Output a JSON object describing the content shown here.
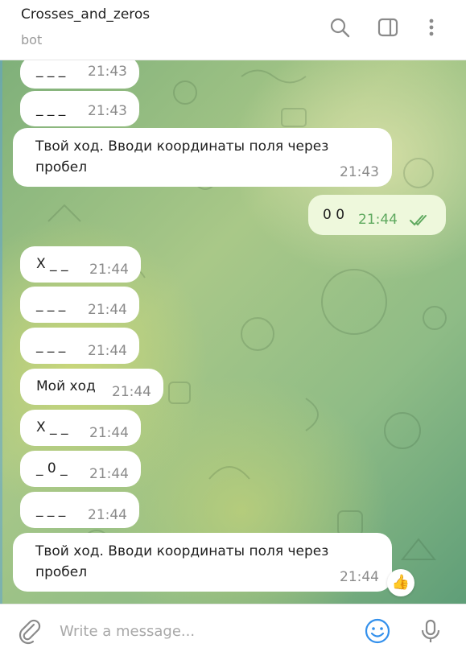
{
  "header": {
    "title": "Crosses_and_zeros",
    "status": "bot",
    "icons": [
      "search-icon",
      "sidebar-toggle-icon",
      "more-vertical-icon"
    ]
  },
  "colors": {
    "accent": "#3390ec",
    "outgoing_bubble": "#eef8dc",
    "outgoing_time": "#5fa95f",
    "time": "#8a8a8a"
  },
  "messages": [
    {
      "text": "_ _ _",
      "time": "21:43",
      "direction": "in"
    },
    {
      "text": "_ _ _",
      "time": "21:43",
      "direction": "in"
    },
    {
      "text": "Твой ход. Вводи координаты поля через пробел",
      "time": "21:43",
      "direction": "in"
    },
    {
      "text": "0 0",
      "time": "21:44",
      "direction": "out",
      "status": "read"
    },
    {
      "text": "X _ _",
      "time": "21:44",
      "direction": "in"
    },
    {
      "text": "_ _ _",
      "time": "21:44",
      "direction": "in"
    },
    {
      "text": "_ _ _",
      "time": "21:44",
      "direction": "in"
    },
    {
      "text": "Мой ход",
      "time": "21:44",
      "direction": "in"
    },
    {
      "text": "X _ _",
      "time": "21:44",
      "direction": "in"
    },
    {
      "text": "_ 0 _",
      "time": "21:44",
      "direction": "in"
    },
    {
      "text": "_ _ _",
      "time": "21:44",
      "direction": "in"
    },
    {
      "text": "Твой ход. Вводи координаты поля через пробел",
      "time": "21:44",
      "direction": "in",
      "reaction": "👍"
    }
  ],
  "composer": {
    "placeholder": "Write a message...",
    "icons": [
      "attach-icon",
      "emoji-icon",
      "microphone-icon"
    ]
  }
}
